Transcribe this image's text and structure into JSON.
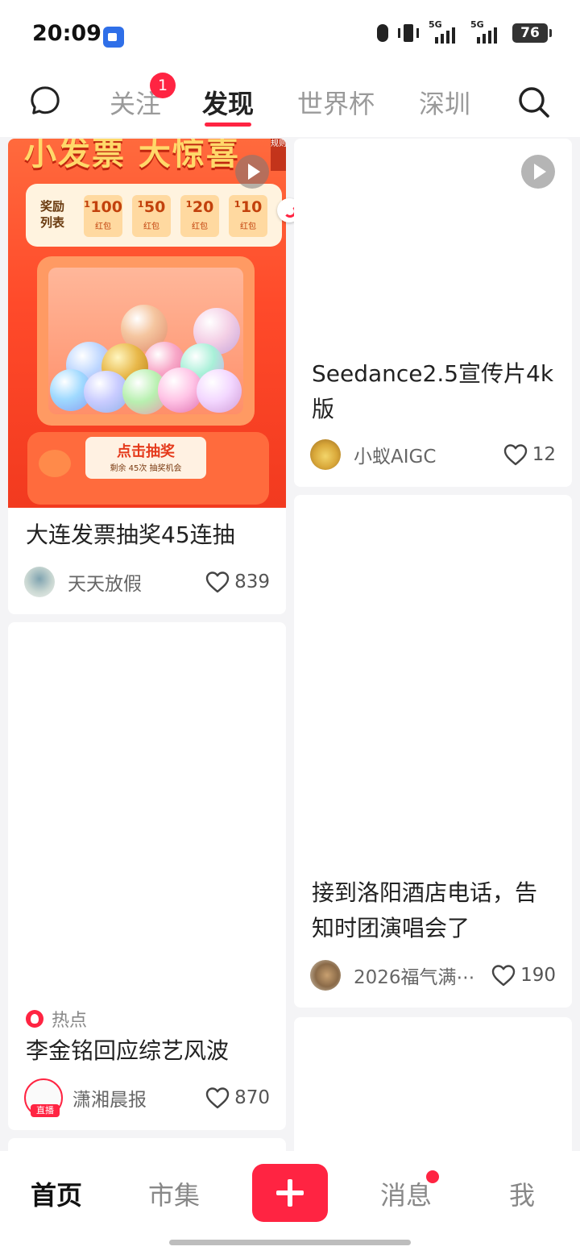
{
  "status_bar": {
    "time": "20:09",
    "signal1_label": "5G",
    "signal2_label": "5G",
    "battery": "76"
  },
  "top_nav": {
    "tabs": [
      {
        "label": "关注",
        "badge": "1"
      },
      {
        "label": "发现",
        "active": true
      },
      {
        "label": "世界杯"
      },
      {
        "label": "深圳"
      }
    ],
    "icons": [
      "chat-bubble-icon",
      "search-icon"
    ]
  },
  "feed": {
    "cards": [
      {
        "title": "大连发票抽奖45连抽",
        "author": "天天放假",
        "likes": "839",
        "cover": {
          "headline": "小发票 大惊喜",
          "list_label": "奖励列表",
          "prizes": [
            {
              "amount": "¹100",
              "label": "红包"
            },
            {
              "amount": "¹50",
              "label": "红包"
            },
            {
              "amount": "¹20",
              "label": "红包"
            },
            {
              "amount": "¹10",
              "label": "红包"
            }
          ],
          "button_text": "点击抽奖",
          "button_sub": "剩余 45次 抽奖机会",
          "rules": "规则"
        }
      },
      {
        "title": "Seedance2.5宣传片4k版",
        "author": "小蚁AIGC",
        "likes": "12"
      },
      {
        "tag": "热点",
        "title": "李金铭回应综艺风波",
        "author": "潇湘晨报",
        "likes": "870",
        "avatar_tag": "直播"
      },
      {
        "title": "接到洛阳酒店电话，告知时团演唱会了",
        "author": "2026福气满⋯",
        "likes": "190"
      }
    ]
  },
  "bottom_nav": {
    "items": [
      {
        "label": "首页",
        "active": true
      },
      {
        "label": "市集"
      },
      {
        "label": "消息",
        "dot": true
      },
      {
        "label": "我"
      }
    ],
    "accent": "#ff2442"
  }
}
